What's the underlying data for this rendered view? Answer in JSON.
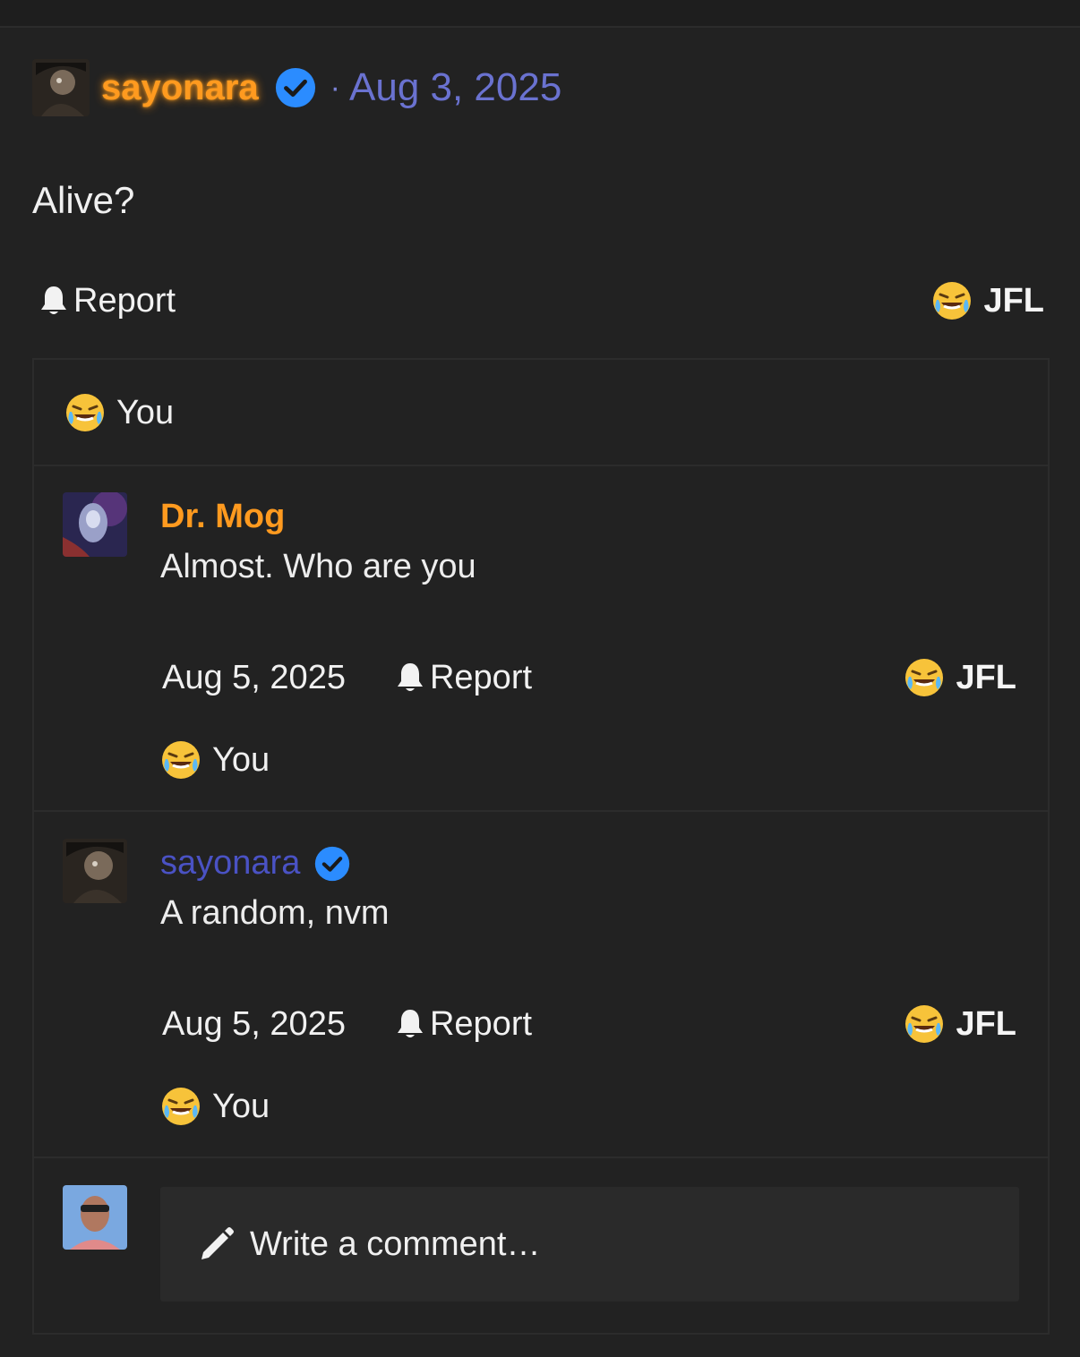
{
  "post": {
    "author": "sayonara",
    "date": "Aug 3, 2025",
    "separator": "·",
    "body": "Alive?",
    "report_label": "Report",
    "reaction_label": "JFL",
    "reacted_by": "You"
  },
  "comments": [
    {
      "author": "Dr. Mog",
      "text": "Almost. Who are you",
      "date": "Aug 5, 2025",
      "report_label": "Report",
      "reaction_label": "JFL",
      "reacted_by": "You"
    },
    {
      "author": "sayonara",
      "text": "A random, nvm",
      "date": "Aug 5, 2025",
      "report_label": "Report",
      "reaction_label": "JFL",
      "reacted_by": "You"
    }
  ],
  "composer": {
    "placeholder": "Write a comment…"
  },
  "colors": {
    "background": "#222222",
    "op_name": "#ff9a1f",
    "date_link": "#6a72d0",
    "verified": "#2b8cff",
    "commenter_blue": "#4a52c4"
  },
  "icons": {
    "verified": "verified-badge-icon",
    "report": "bell-icon",
    "reaction": "crying-laughing-emoji-icon",
    "composer": "pencil-icon"
  }
}
